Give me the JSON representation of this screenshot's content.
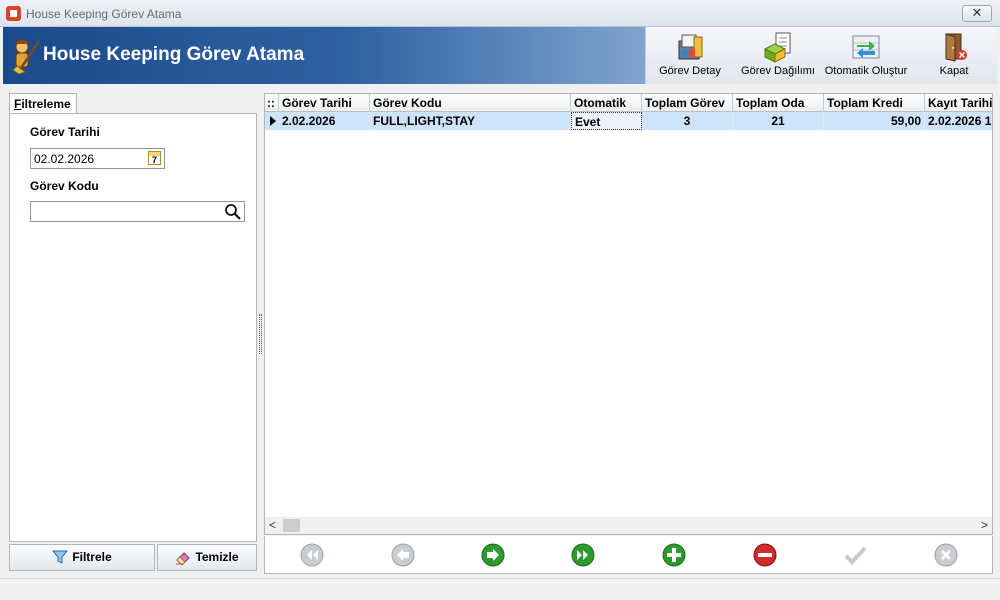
{
  "window": {
    "title": "House Keeping Görev Atama",
    "close_glyph": "✕"
  },
  "header": {
    "title": "House Keeping Görev Atama",
    "icon": "broom-worker-icon"
  },
  "toolbar": {
    "items": [
      {
        "label": "Görev Detay",
        "icon": "task-detail-icon"
      },
      {
        "label": "Görev Dağılımı",
        "icon": "task-distribution-icon"
      },
      {
        "label": "Otomatik Oluştur",
        "icon": "auto-generate-icon"
      },
      {
        "label": "Kapat",
        "icon": "exit-door-icon"
      }
    ]
  },
  "filter": {
    "tab_label_underlined": "F",
    "tab_label_rest": "iltreleme",
    "date_label": "Görev Tarihi",
    "date_value": "02.02.2026",
    "calendar_glyph": "7",
    "code_label": "Görev Kodu",
    "code_value": "",
    "filter_button": "Filtrele",
    "clear_button": "Temizle"
  },
  "grid": {
    "corner": "::",
    "columns": [
      "Görev Tarihi",
      "Görev Kodu",
      "Otomatik",
      "Toplam Görev",
      "Toplam Oda",
      "Toplam Kredi",
      "Kayıt Tarihi"
    ],
    "rows": [
      [
        "2.02.2026",
        "FULL,LIGHT,STAY",
        "Evet",
        "3",
        "21",
        "59,00",
        "2.02.2026 1"
      ]
    ]
  },
  "scroll": {
    "left": "<",
    "right": ">"
  },
  "nav": [
    "first-icon",
    "previous-icon",
    "next-icon",
    "last-icon",
    "add-icon",
    "delete-icon",
    "confirm-icon",
    "cancel-icon"
  ],
  "colors": {
    "header_dark": "#1b4a8c",
    "selected_row": "#cfe3f8",
    "nav_green": "#2e9a2e",
    "nav_red": "#d22a2a"
  }
}
